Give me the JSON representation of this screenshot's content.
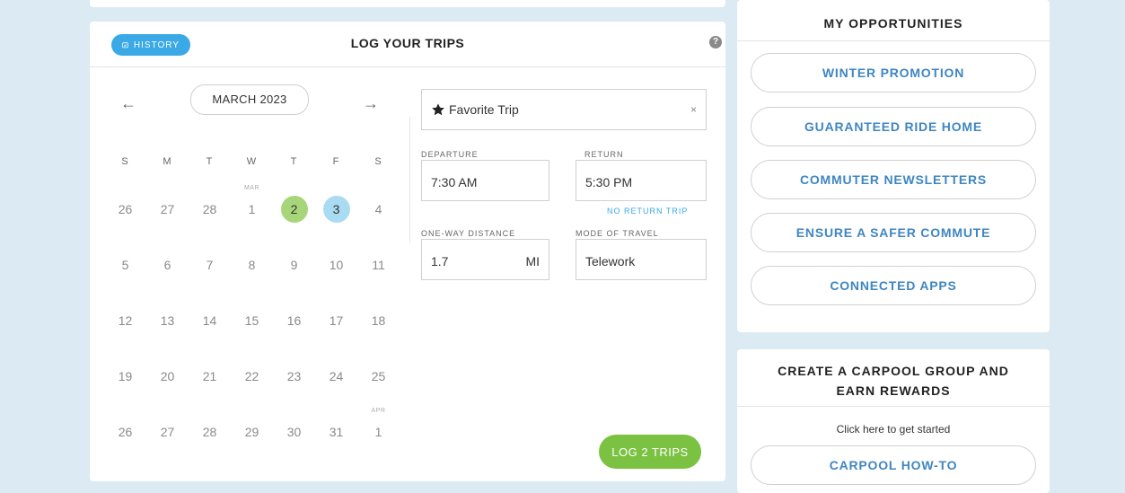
{
  "log": {
    "history_label": "HISTORY",
    "title": "LOG YOUR TRIPS",
    "help_glyph": "?",
    "prev_glyph": "←",
    "next_glyph": "→",
    "month": "MARCH 2023",
    "weekdays": [
      "S",
      "M",
      "T",
      "W",
      "T",
      "F",
      "S"
    ],
    "weeks": [
      [
        {
          "n": "26"
        },
        {
          "n": "27"
        },
        {
          "n": "28"
        },
        {
          "n": "1",
          "label": "MAR"
        },
        {
          "n": "2",
          "state": "green"
        },
        {
          "n": "3",
          "state": "blue"
        },
        {
          "n": "4"
        }
      ],
      [
        {
          "n": "5"
        },
        {
          "n": "6"
        },
        {
          "n": "7"
        },
        {
          "n": "8"
        },
        {
          "n": "9"
        },
        {
          "n": "10"
        },
        {
          "n": "11"
        }
      ],
      [
        {
          "n": "12"
        },
        {
          "n": "13"
        },
        {
          "n": "14"
        },
        {
          "n": "15"
        },
        {
          "n": "16"
        },
        {
          "n": "17"
        },
        {
          "n": "18"
        }
      ],
      [
        {
          "n": "19"
        },
        {
          "n": "20"
        },
        {
          "n": "21"
        },
        {
          "n": "22"
        },
        {
          "n": "23"
        },
        {
          "n": "24"
        },
        {
          "n": "25"
        }
      ],
      [
        {
          "n": "26"
        },
        {
          "n": "27"
        },
        {
          "n": "28"
        },
        {
          "n": "29"
        },
        {
          "n": "30"
        },
        {
          "n": "31"
        },
        {
          "n": "1",
          "label": "APR"
        }
      ]
    ],
    "favorite_trip": "Favorite Trip",
    "clear_glyph": "×",
    "departure_label": "DEPARTURE",
    "departure_value": "7:30 AM",
    "return_label": "RETURN",
    "return_value": "5:30 PM",
    "no_return_label": "NO RETURN TRIP",
    "distance_label": "ONE-WAY DISTANCE",
    "distance_value": "1.7",
    "distance_unit": "MI",
    "mode_label": "MODE OF TRAVEL",
    "mode_value": "Telework",
    "log_button": "LOG 2 TRIPS"
  },
  "opportunities": {
    "title": "MY OPPORTUNITIES",
    "items": [
      "WINTER PROMOTION",
      "GUARANTEED RIDE HOME",
      "COMMUTER NEWSLETTERS",
      "ENSURE A SAFER COMMUTE",
      "CONNECTED APPS"
    ]
  },
  "carpool": {
    "title_line1": "CREATE A CARPOOL GROUP AND",
    "title_line2": "EARN REWARDS",
    "subtitle": "Click here to get started",
    "button": "CARPOOL HOW-TO"
  },
  "colors": {
    "accent_blue": "#3aa9e6",
    "link_blue": "#3f86c1",
    "green": "#7bc142",
    "day_green": "#a7d67a",
    "day_blue": "#a9dbf2",
    "background": "#dbeaf3"
  }
}
